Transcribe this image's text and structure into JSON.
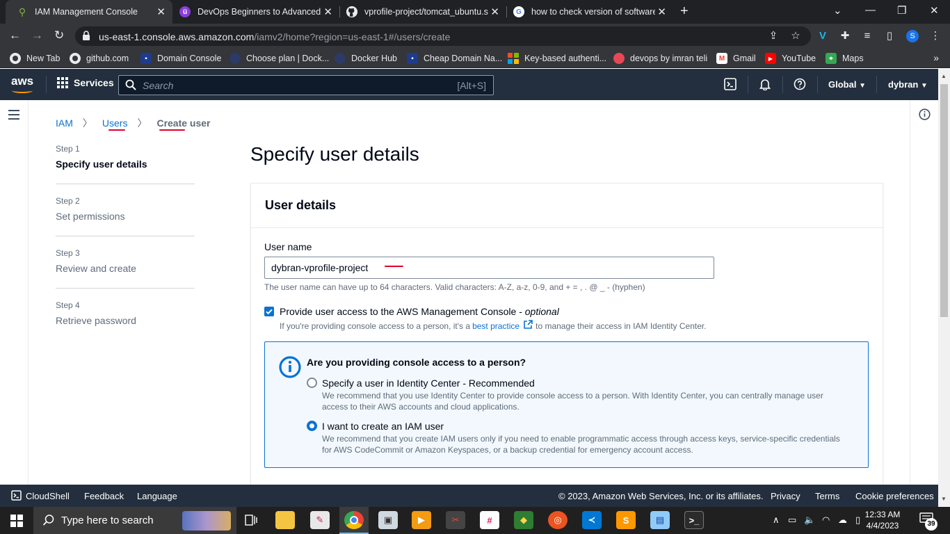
{
  "browser": {
    "tabs": [
      {
        "title": "IAM Management Console",
        "active": true
      },
      {
        "title": "DevOps Beginners to Advanced |",
        "active": false
      },
      {
        "title": "vprofile-project/tomcat_ubuntu.s",
        "active": false
      },
      {
        "title": "how to check version of software",
        "active": false
      }
    ],
    "url_host": "us-east-1.console.aws.amazon.com",
    "url_path": "/iamv2/home?region=us-east-1#/users/create",
    "profile_initial": "S",
    "bookmarks": [
      "New Tab",
      "github.com",
      "Domain Console",
      "Choose plan | Dock...",
      "Docker Hub",
      "Cheap Domain Na...",
      "Key-based authenti...",
      "devops by imran teli",
      "Gmail",
      "YouTube",
      "Maps"
    ]
  },
  "aws_header": {
    "logo": "aws",
    "services_label": "Services",
    "search_placeholder": "Search",
    "search_shortcut": "[Alt+S]",
    "region": "Global",
    "account": "dybran"
  },
  "breadcrumb": {
    "iam": "IAM",
    "users": "Users",
    "current": "Create user"
  },
  "steps": [
    {
      "num": "Step 1",
      "name": "Specify user details",
      "active": true
    },
    {
      "num": "Step 2",
      "name": "Set permissions",
      "active": false
    },
    {
      "num": "Step 3",
      "name": "Review and create",
      "active": false
    },
    {
      "num": "Step 4",
      "name": "Retrieve password",
      "active": false
    }
  ],
  "page_title": "Specify user details",
  "user_details": {
    "heading": "User details",
    "username_label": "User name",
    "username_value": "dybran-vprofile-project",
    "username_hint": "The user name can have up to 64 characters. Valid characters: A-Z, a-z, 0-9, and + = , . @ _ - (hyphen)",
    "console_access_label": "Provide user access to the AWS Management Console - ",
    "console_access_optional": "optional",
    "console_access_checked": true,
    "console_desc_prefix": "If you're providing console access to a person, it's a",
    "console_desc_link": "best practice",
    "console_desc_suffix": "to manage their access in IAM Identity Center."
  },
  "access_question": {
    "question": "Are you providing console access to a person?",
    "options": [
      {
        "label": "Specify a user in Identity Center - Recommended",
        "desc": "We recommend that you use Identity Center to provide console access to a person. With Identity Center, you can centrally manage user access to their AWS accounts and cloud applications.",
        "selected": false
      },
      {
        "label": "I want to create an IAM user",
        "desc": "We recommend that you create IAM users only if you need to enable programmatic access through access keys, service-specific credentials for AWS CodeCommit or Amazon Keyspaces, or a backup credential for emergency account access.",
        "selected": true
      }
    ]
  },
  "aws_footer": {
    "cloudshell": "CloudShell",
    "feedback": "Feedback",
    "language": "Language",
    "copyright": "© 2023, Amazon Web Services, Inc. or its affiliates.",
    "privacy": "Privacy",
    "terms": "Terms",
    "cookies": "Cookie preferences"
  },
  "taskbar": {
    "search_text": "Type here to search",
    "time": "12:33 AM",
    "date": "4/4/2023",
    "notification_count": "39"
  },
  "colors": {
    "aws_nav": "#232f3e",
    "aws_orange": "#ff9900",
    "link_blue": "#0972d3",
    "annotation_red": "#e0002a"
  }
}
